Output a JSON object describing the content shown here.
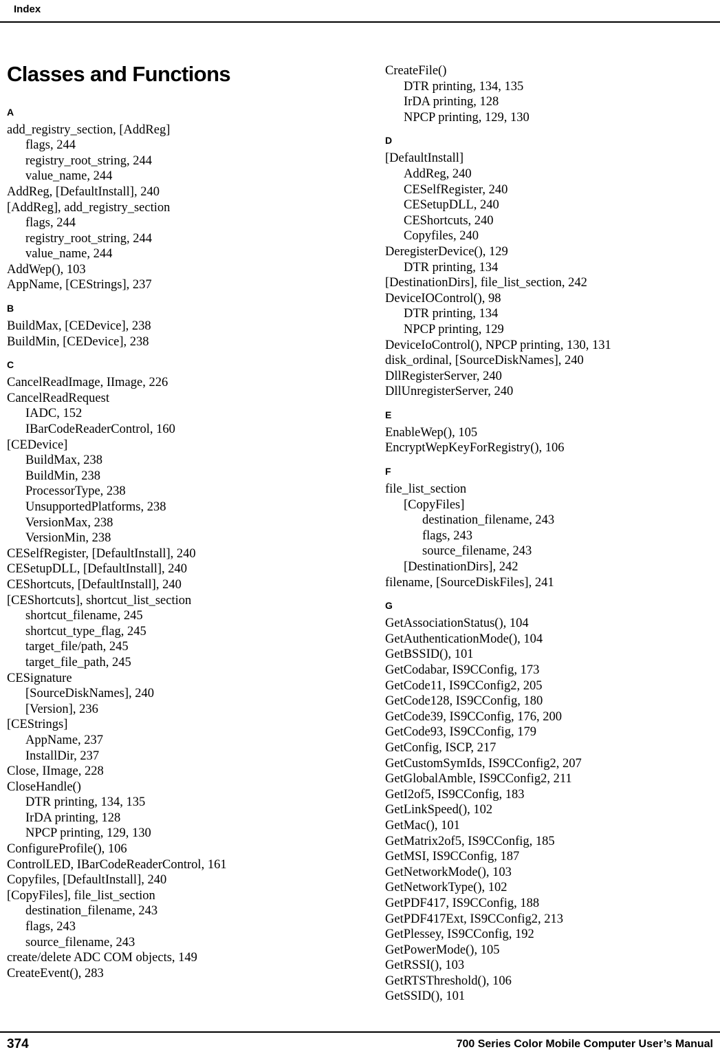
{
  "header": {
    "title": "Index"
  },
  "footer": {
    "page_number": "374",
    "manual_title": "700 Series Color Mobile Computer User’s Manual"
  },
  "document": {
    "title": "Classes and Functions"
  },
  "columns": [
    {
      "groups": [
        {
          "letter": "A",
          "entries": [
            {
              "level": 0,
              "text": "add_registry_section, [AddReg]"
            },
            {
              "level": 1,
              "text": "flags, 244"
            },
            {
              "level": 1,
              "text": "registry_root_string, 244"
            },
            {
              "level": 1,
              "text": "value_name, 244"
            },
            {
              "level": 0,
              "text": "AddReg, [DefaultInstall], 240"
            },
            {
              "level": 0,
              "text": "[AddReg], add_registry_section"
            },
            {
              "level": 1,
              "text": "flags, 244"
            },
            {
              "level": 1,
              "text": "registry_root_string, 244"
            },
            {
              "level": 1,
              "text": "value_name, 244"
            },
            {
              "level": 0,
              "text": "AddWep(), 103"
            },
            {
              "level": 0,
              "text": "AppName, [CEStrings], 237"
            }
          ]
        },
        {
          "letter": "B",
          "entries": [
            {
              "level": 0,
              "text": "BuildMax, [CEDevice], 238"
            },
            {
              "level": 0,
              "text": "BuildMin, [CEDevice], 238"
            }
          ]
        },
        {
          "letter": "C",
          "entries": [
            {
              "level": 0,
              "text": "CancelReadImage, IImage, 226"
            },
            {
              "level": 0,
              "text": "CancelReadRequest"
            },
            {
              "level": 1,
              "text": "IADC, 152"
            },
            {
              "level": 1,
              "text": "IBarCodeReaderControl, 160"
            },
            {
              "level": 0,
              "text": "[CEDevice]"
            },
            {
              "level": 1,
              "text": "BuildMax, 238"
            },
            {
              "level": 1,
              "text": "BuildMin, 238"
            },
            {
              "level": 1,
              "text": "ProcessorType, 238"
            },
            {
              "level": 1,
              "text": "UnsupportedPlatforms, 238"
            },
            {
              "level": 1,
              "text": "VersionMax, 238"
            },
            {
              "level": 1,
              "text": "VersionMin, 238"
            },
            {
              "level": 0,
              "text": "CESelfRegister, [DefaultInstall], 240"
            },
            {
              "level": 0,
              "text": "CESetupDLL, [DefaultInstall], 240"
            },
            {
              "level": 0,
              "text": "CEShortcuts, [DefaultInstall], 240"
            },
            {
              "level": 0,
              "text": "[CEShortcuts], shortcut_list_section"
            },
            {
              "level": 1,
              "text": "shortcut_filename, 245"
            },
            {
              "level": 1,
              "text": "shortcut_type_flag, 245"
            },
            {
              "level": 1,
              "text": "target_file/path, 245"
            },
            {
              "level": 1,
              "text": "target_file_path, 245"
            },
            {
              "level": 0,
              "text": "CESignature"
            },
            {
              "level": 1,
              "text": "[SourceDiskNames], 240"
            },
            {
              "level": 1,
              "text": "[Version], 236"
            },
            {
              "level": 0,
              "text": "[CEStrings]"
            },
            {
              "level": 1,
              "text": "AppName, 237"
            },
            {
              "level": 1,
              "text": "InstallDir, 237"
            },
            {
              "level": 0,
              "text": "Close, IImage, 228"
            },
            {
              "level": 0,
              "text": "CloseHandle()"
            },
            {
              "level": 1,
              "text": "DTR printing, 134, 135"
            },
            {
              "level": 1,
              "text": "IrDA printing, 128"
            },
            {
              "level": 1,
              "text": "NPCP printing, 129, 130"
            },
            {
              "level": 0,
              "text": "ConfigureProfile(), 106"
            },
            {
              "level": 0,
              "text": "ControlLED, IBarCodeReaderControl, 161"
            },
            {
              "level": 0,
              "text": "Copyfiles, [DefaultInstall], 240"
            },
            {
              "level": 0,
              "text": "[CopyFiles], file_list_section"
            },
            {
              "level": 1,
              "text": "destination_filename, 243"
            },
            {
              "level": 1,
              "text": "flags, 243"
            },
            {
              "level": 1,
              "text": "source_filename, 243"
            },
            {
              "level": 0,
              "text": "create/delete ADC COM objects, 149"
            },
            {
              "level": 0,
              "text": "CreateEvent(), 283"
            }
          ]
        }
      ]
    },
    {
      "groups": [
        {
          "letter": "",
          "entries": [
            {
              "level": 0,
              "text": "CreateFile()"
            },
            {
              "level": 1,
              "text": "DTR printing, 134, 135"
            },
            {
              "level": 1,
              "text": "IrDA printing, 128"
            },
            {
              "level": 1,
              "text": "NPCP printing, 129, 130"
            }
          ]
        },
        {
          "letter": "D",
          "entries": [
            {
              "level": 0,
              "text": "[DefaultInstall]"
            },
            {
              "level": 1,
              "text": "AddReg, 240"
            },
            {
              "level": 1,
              "text": "CESelfRegister, 240"
            },
            {
              "level": 1,
              "text": "CESetupDLL, 240"
            },
            {
              "level": 1,
              "text": "CEShortcuts, 240"
            },
            {
              "level": 1,
              "text": "Copyfiles, 240"
            },
            {
              "level": 0,
              "text": "DeregisterDevice(), 129"
            },
            {
              "level": 1,
              "text": "DTR printing, 134"
            },
            {
              "level": 0,
              "text": "[DestinationDirs], file_list_section, 242"
            },
            {
              "level": 0,
              "text": "DeviceIOControl(), 98"
            },
            {
              "level": 1,
              "text": "DTR printing, 134"
            },
            {
              "level": 1,
              "text": "NPCP printing, 129"
            },
            {
              "level": 0,
              "text": "DeviceIoControl(), NPCP printing, 130, 131"
            },
            {
              "level": 0,
              "text": "disk_ordinal, [SourceDiskNames], 240"
            },
            {
              "level": 0,
              "text": "DllRegisterServer, 240"
            },
            {
              "level": 0,
              "text": "DllUnregisterServer, 240"
            }
          ]
        },
        {
          "letter": "E",
          "entries": [
            {
              "level": 0,
              "text": "EnableWep(), 105"
            },
            {
              "level": 0,
              "text": "EncryptWepKeyForRegistry(), 106"
            }
          ]
        },
        {
          "letter": "F",
          "entries": [
            {
              "level": 0,
              "text": "file_list_section"
            },
            {
              "level": 1,
              "text": "[CopyFiles]"
            },
            {
              "level": 2,
              "text": "destination_filename, 243"
            },
            {
              "level": 2,
              "text": "flags, 243"
            },
            {
              "level": 2,
              "text": "source_filename, 243"
            },
            {
              "level": 1,
              "text": "[DestinationDirs], 242"
            },
            {
              "level": 0,
              "text": "filename, [SourceDiskFiles], 241"
            }
          ]
        },
        {
          "letter": "G",
          "entries": [
            {
              "level": 0,
              "text": "GetAssociationStatus(), 104"
            },
            {
              "level": 0,
              "text": "GetAuthenticationMode(), 104"
            },
            {
              "level": 0,
              "text": "GetBSSID(), 101"
            },
            {
              "level": 0,
              "text": "GetCodabar, IS9CConfig, 173"
            },
            {
              "level": 0,
              "text": "GetCode11, IS9CConfig2, 205"
            },
            {
              "level": 0,
              "text": "GetCode128, IS9CConfig, 180"
            },
            {
              "level": 0,
              "text": "GetCode39, IS9CConfig, 176, 200"
            },
            {
              "level": 0,
              "text": "GetCode93, IS9CConfig, 179"
            },
            {
              "level": 0,
              "text": "GetConfig, ISCP, 217"
            },
            {
              "level": 0,
              "text": "GetCustomSymIds, IS9CConfig2, 207"
            },
            {
              "level": 0,
              "text": "GetGlobalAmble, IS9CConfig2, 211"
            },
            {
              "level": 0,
              "text": "GetI2of5, IS9CConfig, 183"
            },
            {
              "level": 0,
              "text": "GetLinkSpeed(), 102"
            },
            {
              "level": 0,
              "text": "GetMac(), 101"
            },
            {
              "level": 0,
              "text": "GetMatrix2of5, IS9CConfig, 185"
            },
            {
              "level": 0,
              "text": "GetMSI, IS9CConfig, 187"
            },
            {
              "level": 0,
              "text": "GetNetworkMode(), 103"
            },
            {
              "level": 0,
              "text": "GetNetworkType(), 102"
            },
            {
              "level": 0,
              "text": "GetPDF417, IS9CConfig, 188"
            },
            {
              "level": 0,
              "text": "GetPDF417Ext, IS9CConfig2, 213"
            },
            {
              "level": 0,
              "text": "GetPlessey, IS9CConfig, 192"
            },
            {
              "level": 0,
              "text": "GetPowerMode(), 105"
            },
            {
              "level": 0,
              "text": "GetRSSI(), 103"
            },
            {
              "level": 0,
              "text": "GetRTSThreshold(), 106"
            },
            {
              "level": 0,
              "text": "GetSSID(), 101"
            }
          ]
        }
      ]
    }
  ]
}
